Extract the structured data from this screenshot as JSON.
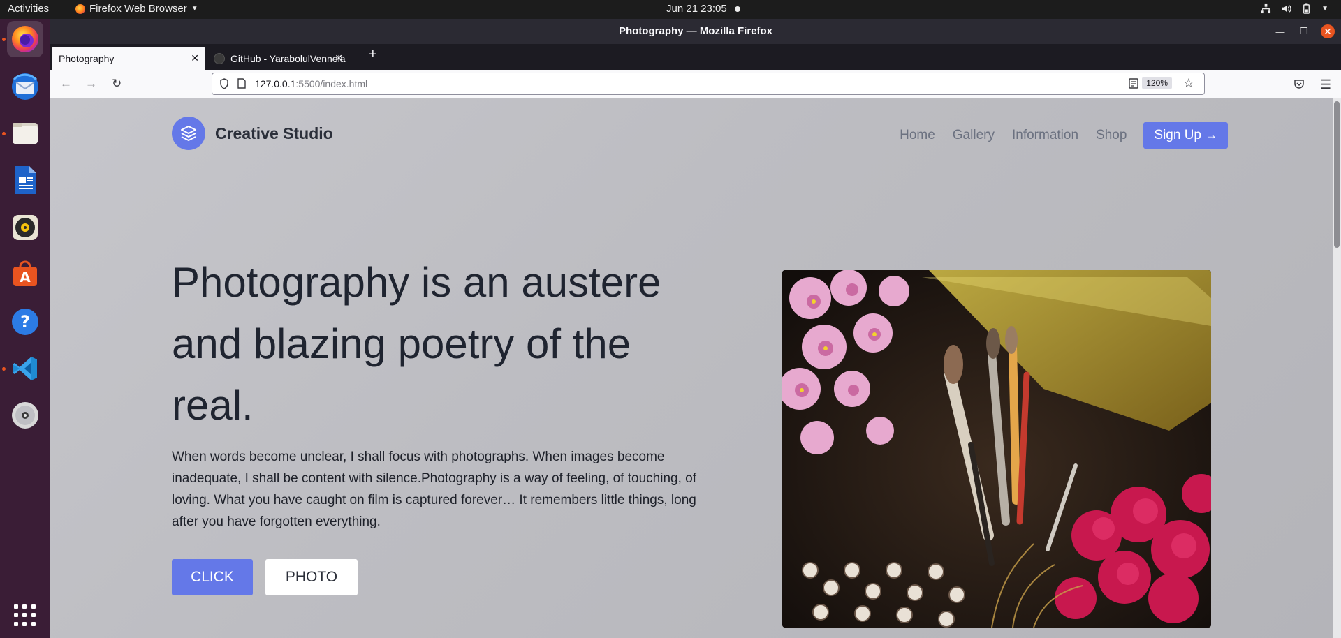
{
  "system": {
    "activities": "Activities",
    "app_menu": "Firefox Web Browser",
    "clock": "Jun 21  23:05"
  },
  "window": {
    "title": "Photography — Mozilla Firefox"
  },
  "tabs": [
    {
      "label": "Photography"
    },
    {
      "label": "GitHub - YarabolulVennela"
    }
  ],
  "urlbar": {
    "host": "127.0.0.1",
    "path": ":5500/index.html",
    "zoom": "120%"
  },
  "site": {
    "brand": "Creative Studio",
    "nav": [
      "Home",
      "Gallery",
      "Information",
      "Shop"
    ],
    "signup_label": "Sign Up",
    "hero_title": "Photography is an austere and blazing poetry of the real.",
    "hero_text": "When words become unclear, I shall focus with photographs. When images become inadequate, I shall be content with silence.Photography is a way of feeling, of touching, of loving. What you have caught on film is captured forever… It remembers little things, long after you have forgotten everything.",
    "btn_click": "CLICK",
    "btn_photo": "PHOTO",
    "accent": "#6478e8"
  },
  "icons": {
    "dock": [
      "firefox-icon",
      "thunderbird-icon",
      "files-icon",
      "writer-icon",
      "rhythmbox-icon",
      "software-icon",
      "help-icon",
      "vscode-icon",
      "dvd-icon",
      "show-apps-icon"
    ]
  }
}
